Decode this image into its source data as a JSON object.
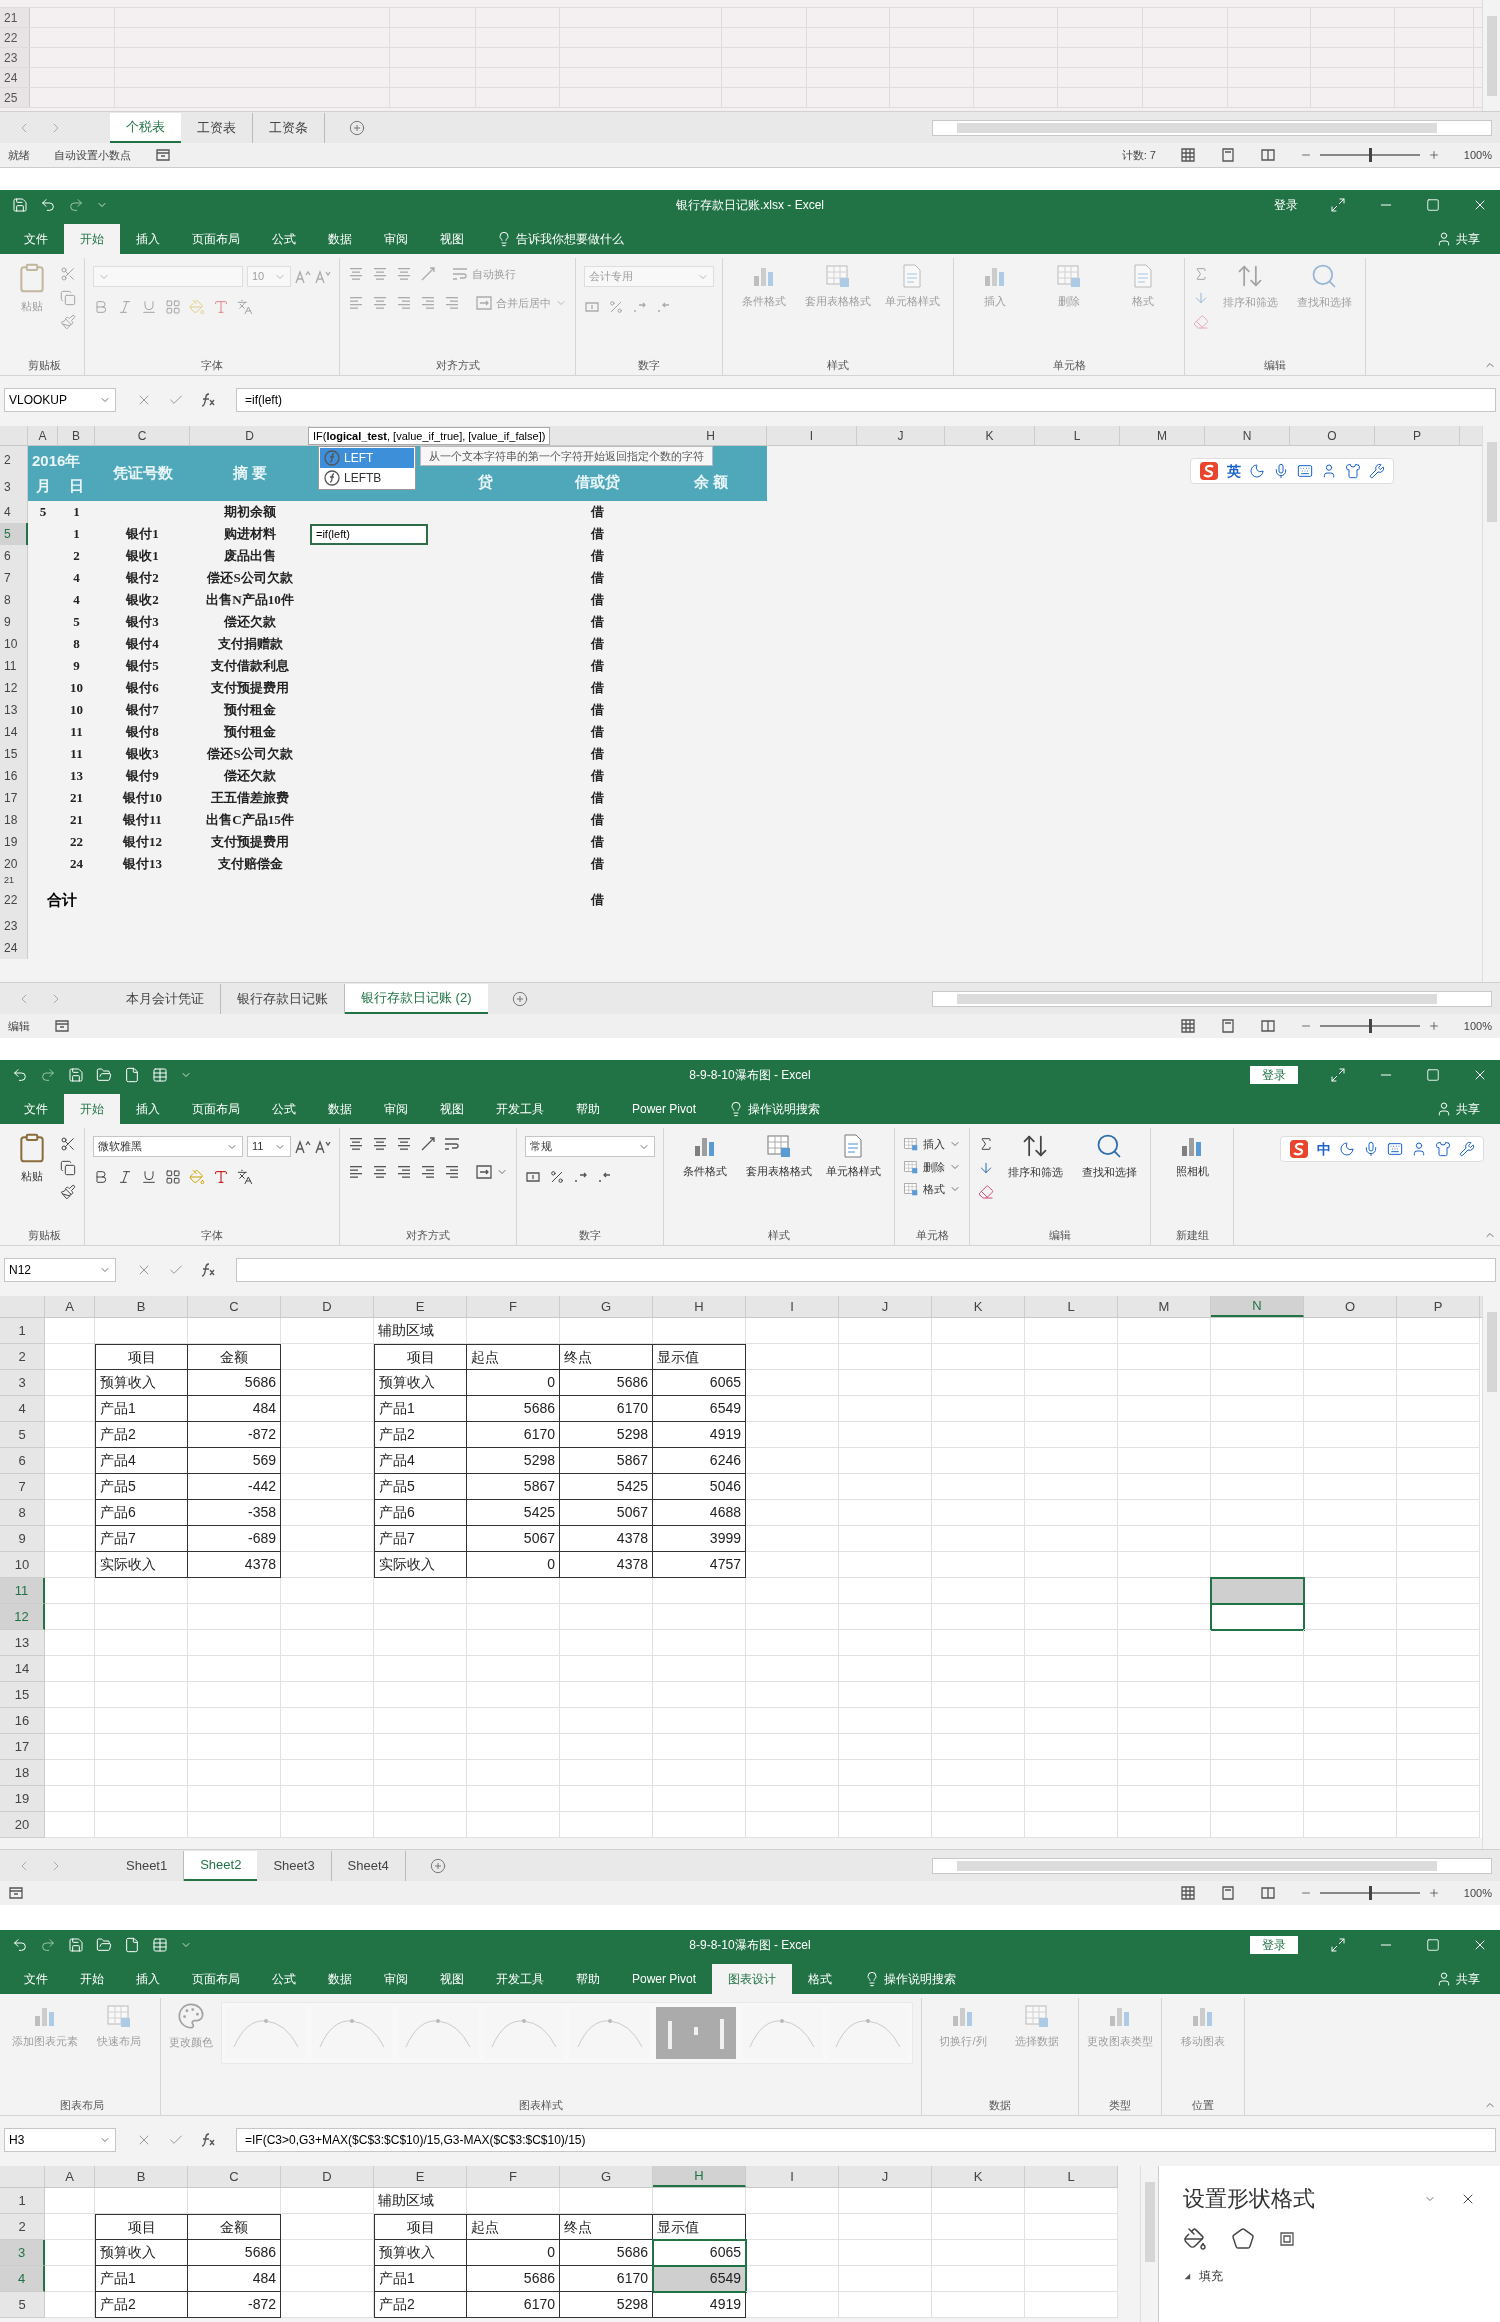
{
  "windows": [
    {
      "kind": "fragment",
      "rows": [
        "21",
        "22",
        "23",
        "24",
        "25"
      ],
      "sheet_tabs": [
        {
          "label": "个税表",
          "selected": true
        },
        {
          "label": "工资表",
          "selected": false
        },
        {
          "label": "工资条",
          "selected": false
        }
      ],
      "status_bar": {
        "mode": "就绪",
        "items": [
          "自动设置小数点"
        ],
        "count": "计数: 7",
        "zoom_slider": {
          "level": 0.5
        },
        "zoom": "100%"
      }
    },
    {
      "kind": "ledger",
      "title": "银行存款日记账.xlsx - Excel",
      "login": "登录",
      "share": "共享",
      "menu_tabs": [
        {
          "label": "文件",
          "selected": false
        },
        {
          "label": "开始",
          "selected": true
        },
        {
          "label": "插入",
          "selected": false
        },
        {
          "label": "页面布局",
          "selected": false
        },
        {
          "label": "公式",
          "selected": false
        },
        {
          "label": "数据",
          "selected": false
        },
        {
          "label": "审阅",
          "selected": false
        },
        {
          "label": "视图",
          "selected": false
        }
      ],
      "tell_me": "告诉我你想要做什么",
      "ribbon_dimmed": true,
      "ribbon": [
        {
          "kind": "clipboard",
          "button": "粘贴",
          "label": "剪贴板"
        },
        {
          "kind": "font",
          "size": "10",
          "label": "字体"
        },
        {
          "kind": "alignment",
          "wrap": "自动换行",
          "merge": "合并后居中",
          "label": "对齐方式"
        },
        {
          "kind": "number",
          "format": "会计专用",
          "label": "数字"
        },
        {
          "kind": "big_buttons",
          "buttons": [
            "条件格式",
            "套用表格格式",
            "单元格样式"
          ],
          "label": "样式"
        },
        {
          "kind": "big_buttons",
          "buttons": [
            "插入",
            "删除",
            "格式"
          ],
          "label": "单元格"
        },
        {
          "kind": "editing",
          "buttons": [
            "排序和筛选",
            "查找和选择"
          ],
          "label": "编辑"
        }
      ],
      "name_box": "VLOOKUP",
      "formula": "=if(left)",
      "columns": [
        "A",
        "B",
        "C",
        "D",
        "H",
        "I",
        "J",
        "K",
        "L",
        "M",
        "N",
        "O",
        "P"
      ],
      "tooltip": "IF(**logical_test**, [value_if_true], [value_if_false])",
      "autocomplete": [
        {
          "label": "LEFT",
          "selected": true
        },
        {
          "label": "LEFTB",
          "selected": false
        }
      ],
      "autocomplete_hint": "从一个文本字符串的第一个字符开始返回指定个数的字符",
      "ime_bar": {
        "language": "英"
      },
      "header_band": {
        "rows": [
          "2",
          "3"
        ],
        "year": "2016年",
        "month": "月",
        "day": "日",
        "voucher": "凭证号数",
        "summary": "摘 要",
        "credit": "贷",
        "direction": "借或贷",
        "balance": "余 额"
      },
      "entries": [
        {
          "kind": "entry",
          "number": "4",
          "selected": false,
          "month": "5",
          "day": "1",
          "summary": "期初余额",
          "direction": "借"
        },
        {
          "kind": "entry",
          "number": "5",
          "selected": true,
          "day": "1",
          "voucher": "银付1",
          "summary": "购进材料",
          "edit_value": "=if(left)",
          "direction": "借"
        },
        {
          "kind": "entry",
          "number": "6",
          "selected": false,
          "day": "2",
          "voucher": "银收1",
          "summary": "废品出售",
          "direction": "借"
        },
        {
          "kind": "entry",
          "number": "7",
          "selected": false,
          "day": "4",
          "voucher": "银付2",
          "summary": "偿还S公司欠款",
          "direction": "借"
        },
        {
          "kind": "entry",
          "number": "8",
          "selected": false,
          "day": "4",
          "voucher": "银收2",
          "summary": "出售N产品10件",
          "direction": "借"
        },
        {
          "kind": "entry",
          "number": "9",
          "selected": false,
          "day": "5",
          "voucher": "银付3",
          "summary": "偿还欠款",
          "direction": "借"
        },
        {
          "kind": "entry",
          "number": "10",
          "selected": false,
          "day": "8",
          "voucher": "银付4",
          "summary": "支付捐赠款",
          "direction": "借"
        },
        {
          "kind": "entry",
          "number": "11",
          "selected": false,
          "day": "9",
          "voucher": "银付5",
          "summary": "支付借款利息",
          "direction": "借"
        },
        {
          "kind": "entry",
          "number": "12",
          "selected": false,
          "day": "10",
          "voucher": "银付6",
          "summary": "支付预提费用",
          "direction": "借"
        },
        {
          "kind": "entry",
          "number": "13",
          "selected": false,
          "day": "10",
          "voucher": "银付7",
          "summary": "预付租金",
          "direction": "借"
        },
        {
          "kind": "entry",
          "number": "14",
          "selected": false,
          "day": "11",
          "voucher": "银付8",
          "summary": "预付租金",
          "direction": "借"
        },
        {
          "kind": "entry",
          "number": "15",
          "selected": false,
          "day": "11",
          "voucher": "银收3",
          "summary": "偿还S公司欠款",
          "direction": "借"
        },
        {
          "kind": "entry",
          "number": "16",
          "selected": false,
          "day": "13",
          "voucher": "银付9",
          "summary": "偿还欠款",
          "direction": "借"
        },
        {
          "kind": "entry",
          "number": "17",
          "selected": false,
          "day": "21",
          "voucher": "银付10",
          "summary": "王五借差旅费",
          "direction": "借"
        },
        {
          "kind": "entry",
          "number": "18",
          "selected": false,
          "day": "21",
          "voucher": "银付11",
          "summary": "出售C产品15件",
          "direction": "借"
        },
        {
          "kind": "entry",
          "number": "19",
          "selected": false,
          "day": "22",
          "voucher": "银付12",
          "summary": "支付预提费用",
          "direction": "借"
        },
        {
          "kind": "entry",
          "number": "20",
          "selected": false,
          "day": "24",
          "voucher": "银付13",
          "summary": "支付赔偿金",
          "direction": "借"
        },
        {
          "kind": "short",
          "number": "21",
          "selected": false
        },
        {
          "kind": "total",
          "number": "22",
          "selected": false,
          "total": "合计",
          "direction": "借"
        },
        {
          "kind": "entry",
          "number": "23",
          "selected": false
        },
        {
          "kind": "entry",
          "number": "24",
          "selected": false
        }
      ],
      "sheet_tabs": [
        {
          "label": "本月会计凭证",
          "selected": false
        },
        {
          "label": "银行存款日记账",
          "selected": false
        },
        {
          "label": "银行存款日记账 (2)",
          "selected": true
        }
      ],
      "status_bar": {
        "mode": "编辑",
        "zoom_slider": {
          "level": 0.5
        },
        "zoom": "100%"
      }
    },
    {
      "kind": "grid",
      "title": "8-9-8-10瀑布图 - Excel",
      "login": "登录",
      "share": "共享",
      "menu_tabs": [
        {
          "label": "文件",
          "selected": false
        },
        {
          "label": "开始",
          "selected": true
        },
        {
          "label": "插入",
          "selected": false
        },
        {
          "label": "页面布局",
          "selected": false
        },
        {
          "label": "公式",
          "selected": false
        },
        {
          "label": "数据",
          "selected": false
        },
        {
          "label": "审阅",
          "selected": false
        },
        {
          "label": "视图",
          "selected": false
        },
        {
          "label": "开发工具",
          "selected": false
        },
        {
          "label": "帮助",
          "selected": false
        },
        {
          "label": "Power Pivot",
          "selected": false
        }
      ],
      "tell_me": "操作说明搜索",
      "ribbon_dimmed": false,
      "ribbon": [
        {
          "kind": "clipboard",
          "button": "粘贴",
          "label": "剪贴板"
        },
        {
          "kind": "font",
          "font": "微软雅黑",
          "size": "11",
          "label": "字体"
        },
        {
          "kind": "alignment",
          "label": "对齐方式"
        },
        {
          "kind": "number",
          "format": "常规",
          "label": "数字"
        },
        {
          "kind": "big_buttons",
          "buttons": [
            "条件格式",
            "套用表格格式",
            "单元格样式"
          ],
          "label": "样式"
        },
        {
          "kind": "small_buttons",
          "buttons": [
            "插入",
            "删除",
            "格式"
          ],
          "label": "单元格"
        },
        {
          "kind": "editing",
          "buttons": [
            "排序和筛选",
            "查找和选择"
          ],
          "label": "编辑"
        },
        {
          "kind": "big_buttons",
          "buttons": [
            "照相机"
          ],
          "label": "新建组"
        }
      ],
      "ime_bar": {
        "language": "中"
      },
      "name_box": "N12",
      "sheet": {
        "columns": [
          {
            "label": "A",
            "selected": false
          },
          {
            "label": "B",
            "selected": false
          },
          {
            "label": "C",
            "selected": false
          },
          {
            "label": "D",
            "selected": false
          },
          {
            "label": "E",
            "selected": false
          },
          {
            "label": "F",
            "selected": false
          },
          {
            "label": "G",
            "selected": false
          },
          {
            "label": "H",
            "selected": false
          },
          {
            "label": "I",
            "selected": false
          },
          {
            "label": "J",
            "selected": false
          },
          {
            "label": "K",
            "selected": false
          },
          {
            "label": "L",
            "selected": false
          },
          {
            "label": "M",
            "selected": false
          },
          {
            "label": "N",
            "selected": true
          },
          {
            "label": "O",
            "selected": false
          },
          {
            "label": "P",
            "selected": false
          }
        ],
        "rows": [
          {
            "label": "1",
            "selected": false
          },
          {
            "label": "2",
            "selected": false
          },
          {
            "label": "3",
            "selected": false
          },
          {
            "label": "4",
            "selected": false
          },
          {
            "label": "5",
            "selected": false
          },
          {
            "label": "6",
            "selected": false
          },
          {
            "label": "7",
            "selected": false
          },
          {
            "label": "8",
            "selected": false
          },
          {
            "label": "9",
            "selected": false
          },
          {
            "label": "10",
            "selected": false
          },
          {
            "label": "11",
            "selected": true,
            "active": false
          },
          {
            "label": "12",
            "selected": true,
            "active": true
          },
          {
            "label": "13",
            "selected": false
          },
          {
            "label": "14",
            "selected": false
          },
          {
            "label": "15",
            "selected": false
          },
          {
            "label": "16",
            "selected": false
          },
          {
            "label": "17",
            "selected": false
          },
          {
            "label": "18",
            "selected": false
          },
          {
            "label": "19",
            "selected": false
          },
          {
            "label": "20",
            "selected": false
          }
        ],
        "caption": "辅助区域",
        "tables": [
          {
            "header": [
              "项目",
              "金额"
            ],
            "rows": [
              [
                "预算收入",
                "5686"
              ],
              [
                "产品1",
                "484"
              ],
              [
                "产品2",
                "-872"
              ],
              [
                "产品4",
                "569"
              ],
              [
                "产品5",
                "-442"
              ],
              [
                "产品6",
                "-358"
              ],
              [
                "产品7",
                "-689"
              ],
              [
                "实际收入",
                "4378"
              ]
            ]
          },
          {
            "header": [
              "项目",
              "起点",
              "终点",
              "显示值"
            ],
            "rows": [
              [
                "预算收入",
                "0",
                "5686",
                "6065"
              ],
              [
                "产品1",
                "5686",
                "6170",
                "6549"
              ],
              [
                "产品2",
                "6170",
                "5298",
                "4919"
              ],
              [
                "产品4",
                "5298",
                "5867",
                "6246"
              ],
              [
                "产品5",
                "5867",
                "5425",
                "5046"
              ],
              [
                "产品6",
                "5425",
                "5067",
                "4688"
              ],
              [
                "产品7",
                "5067",
                "4378",
                "3999"
              ],
              [
                "实际收入",
                "0",
                "4378",
                "4757"
              ]
            ]
          }
        ]
      },
      "sheet_tabs": [
        {
          "label": "Sheet1",
          "selected": false
        },
        {
          "label": "Sheet2",
          "selected": true
        },
        {
          "label": "Sheet3",
          "selected": false
        },
        {
          "label": "Sheet4",
          "selected": false
        }
      ],
      "status_bar": {
        "zoom_slider": {
          "level": 0.5
        },
        "zoom": "100%"
      }
    },
    {
      "kind": "grid",
      "title": "8-9-8-10瀑布图 - Excel",
      "login": "登录",
      "share": "共享",
      "menu_tabs": [
        {
          "label": "文件",
          "selected": false
        },
        {
          "label": "开始",
          "selected": false
        },
        {
          "label": "插入",
          "selected": false
        },
        {
          "label": "页面布局",
          "selected": false
        },
        {
          "label": "公式",
          "selected": false
        },
        {
          "label": "数据",
          "selected": false
        },
        {
          "label": "审阅",
          "selected": false
        },
        {
          "label": "视图",
          "selected": false
        },
        {
          "label": "开发工具",
          "selected": false
        },
        {
          "label": "帮助",
          "selected": false
        },
        {
          "label": "Power Pivot",
          "selected": false
        },
        {
          "label": "图表设计",
          "selected": true
        },
        {
          "label": "格式",
          "selected": false
        }
      ],
      "tell_me": "操作说明搜索",
      "ribbon_dimmed": true,
      "ribbon": [
        {
          "kind": "big_buttons",
          "buttons": [
            "添加图表元素",
            "快速布局"
          ],
          "label": "图表布局"
        },
        {
          "kind": "chart_styles",
          "button": "更改颜色",
          "label": "图表样式"
        },
        {
          "kind": "big_buttons",
          "buttons": [
            "切换行/列",
            "选择数据"
          ],
          "label": "数据"
        },
        {
          "kind": "big_buttons",
          "buttons": [
            "更改图表类型"
          ],
          "label": "类型"
        },
        {
          "kind": "big_buttons",
          "buttons": [
            "移动图表"
          ],
          "label": "位置"
        }
      ],
      "name_box": "H3",
      "formula": "=IF(C3>0,G3+MAX($C$3:$C$10)/15,G3-MAX($C$3:$C$10)/15)",
      "sheet": {
        "columns": [
          {
            "label": "A",
            "selected": false
          },
          {
            "label": "B",
            "selected": false
          },
          {
            "label": "C",
            "selected": false
          },
          {
            "label": "D",
            "selected": false
          },
          {
            "label": "E",
            "selected": false
          },
          {
            "label": "F",
            "selected": false
          },
          {
            "label": "G",
            "selected": false
          },
          {
            "label": "H",
            "selected": true
          },
          {
            "label": "I",
            "selected": false
          },
          {
            "label": "J",
            "selected": false
          },
          {
            "label": "K",
            "selected": false
          },
          {
            "label": "L",
            "selected": false
          }
        ],
        "rows": [
          {
            "label": "1",
            "selected": false
          },
          {
            "label": "2",
            "selected": false
          },
          {
            "label": "3",
            "selected": true,
            "active": true
          },
          {
            "label": "4",
            "selected": true,
            "active": false
          },
          {
            "label": "5",
            "selected": false
          }
        ],
        "caption": "辅助区域",
        "tables": [
          {
            "header": [
              "项目",
              "金额"
            ],
            "rows": [
              [
                "预算收入",
                "5686"
              ],
              [
                "产品1",
                "484"
              ],
              [
                "产品2",
                "-872"
              ]
            ]
          },
          {
            "header": [
              "项目",
              "起点",
              "终点",
              "显示值"
            ],
            "rows": [
              [
                "预算收入",
                "0",
                "5686",
                "6065"
              ],
              [
                "产品1",
                "5686",
                "6170",
                "6549"
              ],
              [
                "产品2",
                "6170",
                "5298",
                "4919"
              ]
            ]
          }
        ]
      },
      "format_pane": {
        "title": "设置形状格式",
        "section": "填充",
        "expanded": true
      }
    }
  ]
}
